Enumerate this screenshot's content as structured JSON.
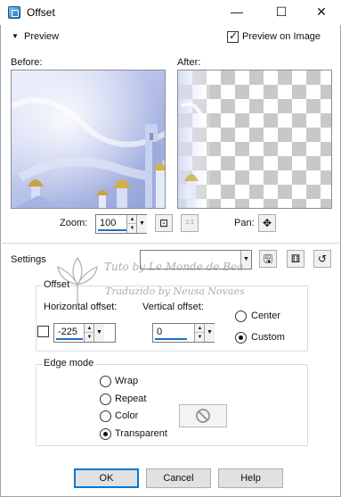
{
  "window": {
    "title": "Offset",
    "controls": {
      "minimize": "—",
      "maximize": "☐",
      "close": "✕"
    }
  },
  "preview_section": {
    "label": "Preview",
    "preview_on_image_label": "Preview on Image",
    "preview_on_image_checked": true,
    "before_label": "Before:",
    "after_label": "After:"
  },
  "zoom": {
    "label": "Zoom:",
    "value": "100",
    "pan_label": "Pan:",
    "actual_size_label": "1:1"
  },
  "settings": {
    "label": "Settings",
    "preset_value": ""
  },
  "offset_group": {
    "legend": "Offset",
    "horizontal_label": "Horizontal offset:",
    "horizontal_value": "-225",
    "vertical_label": "Vertical offset:",
    "vertical_value": "0",
    "center_label": "Center",
    "custom_label": "Custom",
    "selected": "Custom"
  },
  "edge_mode_group": {
    "legend": "Edge mode",
    "options": [
      "Wrap",
      "Repeat",
      "Color",
      "Transparent"
    ],
    "selected": "Transparent"
  },
  "buttons": {
    "ok": "OK",
    "cancel": "Cancel",
    "help": "Help"
  },
  "watermark": {
    "line1": "Tuto by  Le Monde de Bea",
    "line2": "Traduzido by  Neusa Novaes"
  },
  "colors": {
    "accent": "#0078d7",
    "checker": "#c8c8c8",
    "group_border": "#d9dcdf"
  }
}
